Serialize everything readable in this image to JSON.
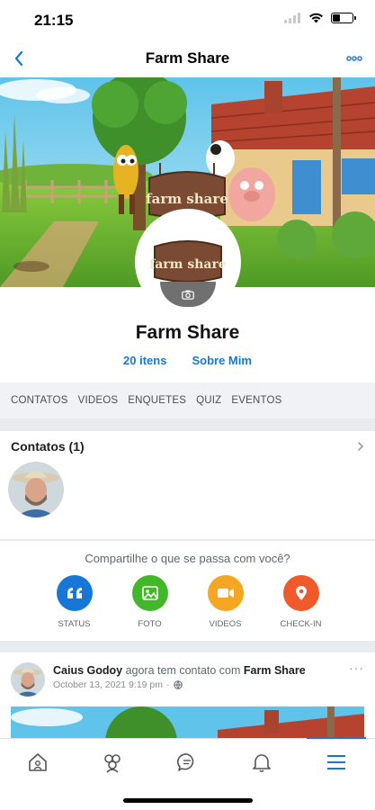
{
  "status_bar": {
    "time": "21:15",
    "battery_level": 0.4
  },
  "nav": {
    "title": "Farm Share",
    "back_icon": "chevron-left-icon",
    "more_icon": "more-dots-icon"
  },
  "cover": {
    "sign_text": "farm share"
  },
  "profile": {
    "logo_text": "farm share",
    "name": "Farm Share",
    "items_link": "20 itens",
    "about_link": "Sobre Mim"
  },
  "tabs": [
    "CONTATOS",
    "VIDEOS",
    "ENQUETES",
    "QUIZ",
    "EVENTOS"
  ],
  "contacts": {
    "title": "Contatos (1)"
  },
  "share": {
    "prompt": "Compartilhe o que se passa com você?",
    "actions": [
      {
        "label": "STATUS",
        "icon": "quote-icon",
        "color": "#1877d6"
      },
      {
        "label": "FOTO",
        "icon": "photo-icon",
        "color": "#42b72a"
      },
      {
        "label": "VIDEOS",
        "icon": "video-camera-icon",
        "color": "#f5a623"
      },
      {
        "label": "CHECK-IN",
        "icon": "map-pin-icon",
        "color": "#f0592a"
      }
    ]
  },
  "post": {
    "author": "Caius Godoy",
    "action": "agora tem contato com",
    "target": "Farm Share",
    "timestamp": "October 13, 2021 9:19 pm",
    "separator": "·",
    "more": "···"
  },
  "tab_bar": {
    "items": [
      "home-icon",
      "friends-icon",
      "chat-icon",
      "bell-icon",
      "menu-icon"
    ],
    "active": "menu-icon"
  },
  "colors": {
    "accent": "#1877d6",
    "background": "#f0f2f5"
  }
}
